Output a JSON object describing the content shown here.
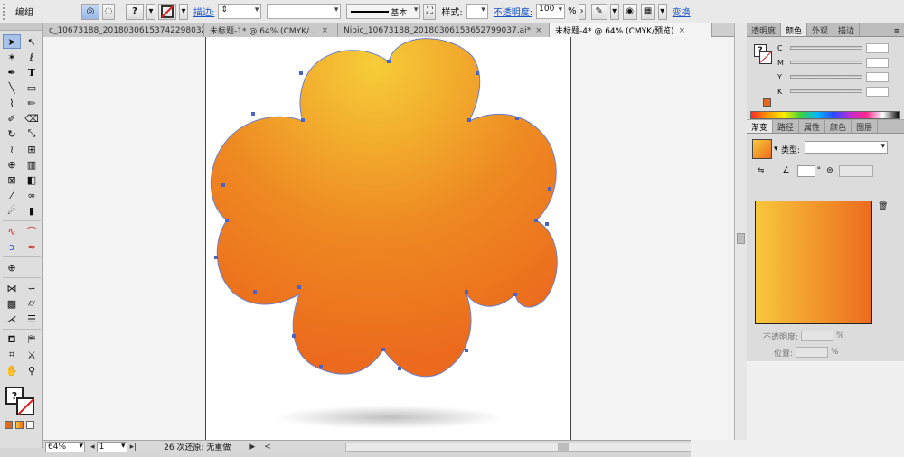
{
  "control_bar": {
    "selection_label": "编组",
    "stroke_label": "描边:",
    "line_style": "基本",
    "style_label": "样式:",
    "opacity_label": "不透明度:",
    "opacity_value": "100",
    "opacity_unit": "%",
    "transform_label": "变换",
    "question_mark": "?"
  },
  "doc_tabs": [
    {
      "label": "c_10673188_20180306153742298032.ai*",
      "active": false
    },
    {
      "label": "未标题-1* @ 64% (CMYK/...",
      "active": false
    },
    {
      "label": "Nipic_10673188_20180306153652799037.ai*",
      "active": false
    },
    {
      "label": "未标题-4* @ 64% (CMYK/预览)",
      "active": true
    }
  ],
  "tab_close": "×",
  "status_bar": {
    "zoom": "64%",
    "page": "1",
    "history": "26 次还原; 无重做",
    "play": "▶",
    "left_arrow": "<"
  },
  "color_panel": {
    "tabs": [
      "透明度",
      "颜色",
      "外观",
      "描边"
    ],
    "active_tab": "颜色",
    "channels": [
      "C",
      "M",
      "Y",
      "K"
    ],
    "menu": "≡"
  },
  "gradient_panel": {
    "tabs": [
      "渐变",
      "路径",
      "属性",
      "颜色",
      "图层"
    ],
    "active_tab": "渐变",
    "type_label": "类型:",
    "angle_unit": "°",
    "opacity_label": "不透明度:",
    "position_label": "位置:",
    "unit": "%",
    "colors": {
      "start": "#f8c73c",
      "end": "#ec6b1e"
    }
  },
  "artwork": {
    "fill_inner": "#f6cd38",
    "fill_outer": "#ec6a1d",
    "path_color": "#5c73c9"
  }
}
